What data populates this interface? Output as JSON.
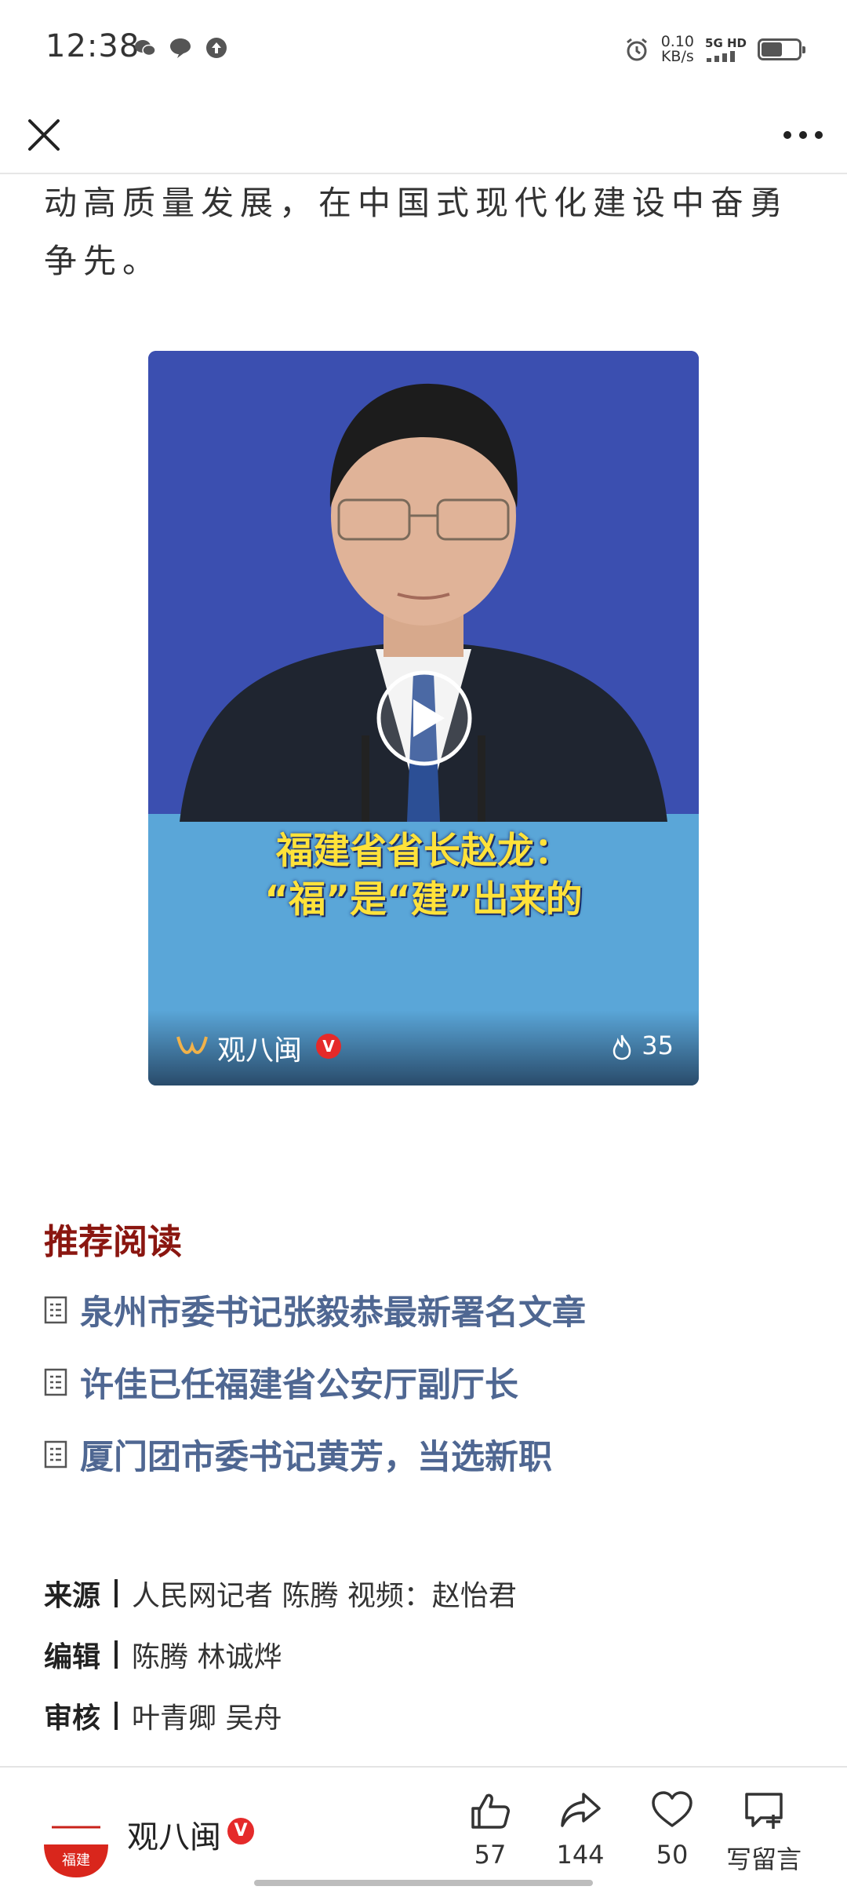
{
  "status_bar": {
    "time": "12:38",
    "net_speed_value": "0.10",
    "net_speed_unit": "KB/s",
    "network": "5G HD"
  },
  "nav": {
    "close_icon": "close-icon",
    "more_icon": "more-icon"
  },
  "article": {
    "text": "动高质量发展，在中国式现代化建设中奋勇争先。"
  },
  "video": {
    "caption_line1": "福建省省长赵龙：",
    "caption_line2": "“福”是“建”出来的",
    "account_name": "观八闽",
    "verified_mark": "V",
    "heat_count": "35"
  },
  "recommend": {
    "title": "推荐阅读",
    "items": [
      {
        "label": "泉州市委书记张毅恭最新署名文章"
      },
      {
        "label": "许佳已任福建省公安厅副厅长"
      },
      {
        "label": "厦门团市委书记黄芳，当选新职"
      }
    ]
  },
  "credits": [
    {
      "key": "来源",
      "value": "人民网记者 陈腾 视频：赵怡君"
    },
    {
      "key": "编辑",
      "value": "陈腾 林诚烨"
    },
    {
      "key": "审核",
      "value": "叶青卿 吴舟"
    }
  ],
  "bottom_bar": {
    "avatar_text": "福建",
    "account_name": "观八闽",
    "verified_mark": "V",
    "likes": "57",
    "shares": "144",
    "favorites": "50",
    "comment_label": "写留言"
  },
  "colors": {
    "recommend_title": "#8a1610",
    "recommend_link": "#4f6792",
    "verified": "#e52a2a",
    "video_bg": "#3b4fb0",
    "caption": "#ffe23a"
  }
}
